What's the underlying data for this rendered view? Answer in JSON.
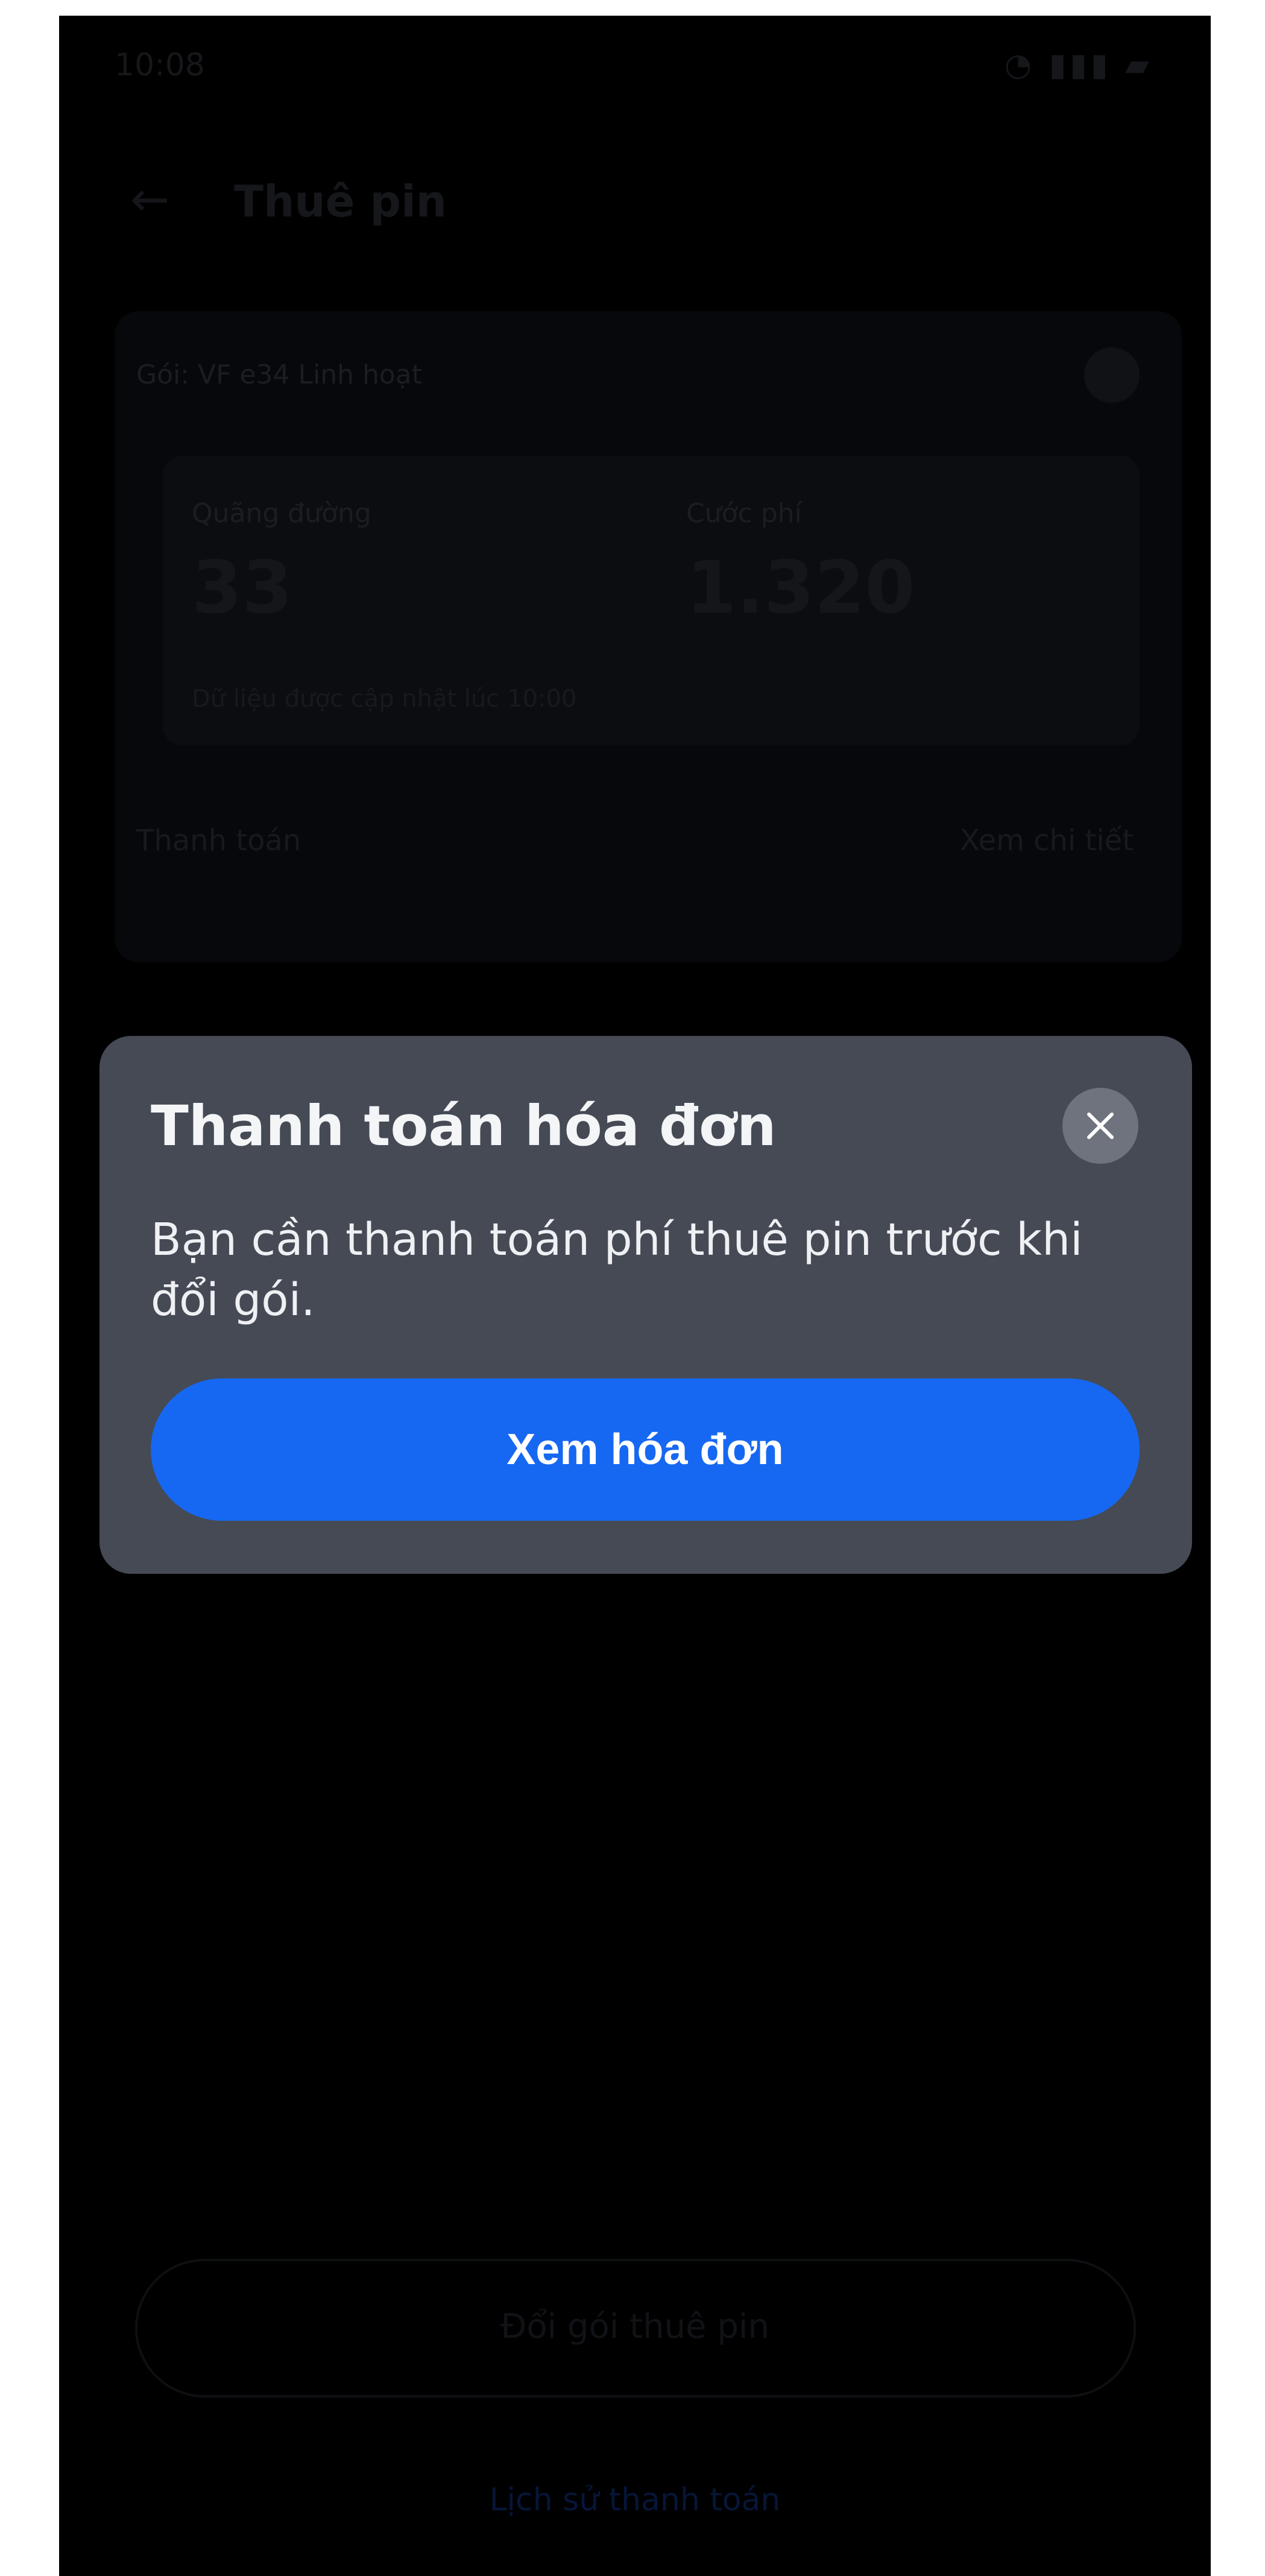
{
  "background": {
    "status_time": "10:08",
    "status_icons": "◔ ▮▮▮ ▰",
    "back_arrow": "←",
    "page_title": "Thuê pin",
    "card_title": "Gói: VF e34 Linh hoạt",
    "stat1_label": "Quãng đường",
    "stat1_value": "33",
    "stat2_label": "Cước phí",
    "stat2_value": "1.320",
    "stat_note": "Dữ liệu được cập nhật lúc 10:00",
    "row_label": "Thanh toán",
    "row_value": "Xem chi tiết",
    "bottom_button": "Đổi gói thuê pin",
    "bottom_link": "Lịch sử thanh toán"
  },
  "dialog": {
    "title": "Thanh toán hóa đơn",
    "body": "Bạn cần thanh toán phí thuê pin trước khi đổi gói.",
    "primary_button": "Xem hóa đơn",
    "close_icon": "close-icon"
  },
  "colors": {
    "overlay": "#000000",
    "dialog_bg": "#454a55",
    "primary": "#1668f2",
    "close_bg": "#6f737d"
  }
}
